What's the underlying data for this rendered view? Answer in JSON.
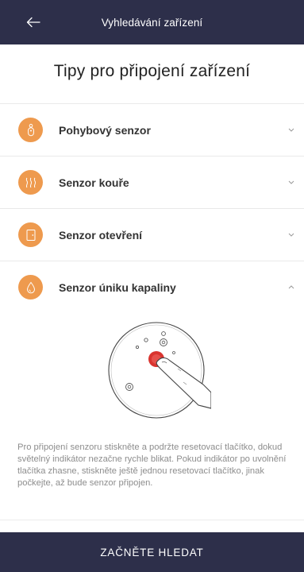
{
  "header": {
    "title": "Vyhledávání zařízení",
    "back_icon": "arrow-left-icon"
  },
  "page_title": "Tipy pro připojení zařízení",
  "accordion": {
    "items": [
      {
        "label": "Pohybový senzor",
        "icon": "motion-sensor-icon",
        "expanded": false
      },
      {
        "label": "Senzor kouře",
        "icon": "smoke-icon",
        "expanded": false
      },
      {
        "label": "Senzor otevření",
        "icon": "door-icon",
        "expanded": false
      },
      {
        "label": "Senzor úniku kapaliny",
        "icon": "water-drop-icon",
        "expanded": true
      }
    ],
    "expanded_description": "Pro připojení senzoru stiskněte a podržte resetovací tlačítko, dokud světelný indikátor nezačne rychle blikat. Pokud indikátor po uvolnění tlačítka zhasne, stiskněte ještě jednou resetovací tlačítko, jinak počkejte, až bude senzor připojen."
  },
  "footer": {
    "button_label": "ZAČNĚTE HLEDAT"
  },
  "colors": {
    "bar_bg": "#2d2f4a",
    "accent_orange": "#ee9a4e",
    "reset_button_red": "#d9342f"
  }
}
